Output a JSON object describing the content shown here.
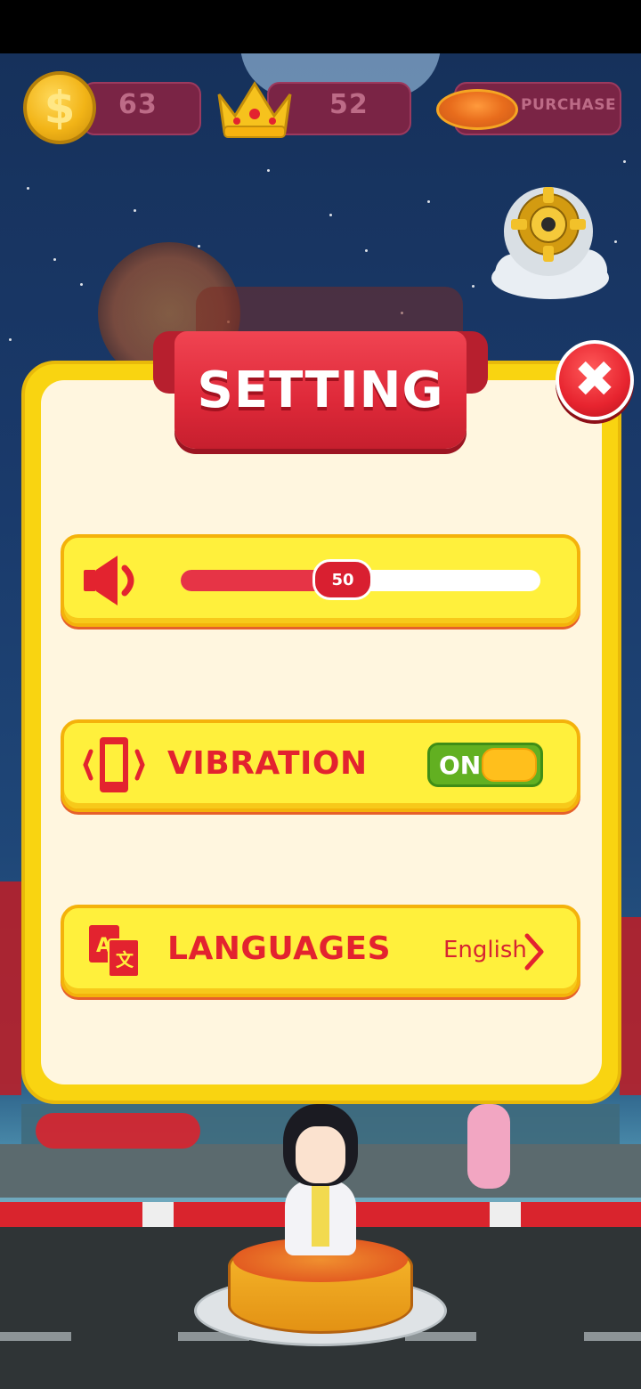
{
  "hud": {
    "coins": "63",
    "crowns": "52",
    "purchase_label": "PURCHASE",
    "coin_symbol": "$"
  },
  "settings": {
    "title": "SETTING",
    "close_symbol": "✖",
    "volume": {
      "value": "50",
      "level": 0.5
    },
    "vibration": {
      "label": "VIBRATION",
      "state": "ON"
    },
    "languages": {
      "label": "LANGUAGES",
      "value": "English"
    }
  },
  "colors": {
    "accent_red": "#e3232f",
    "panel_yellow": "#f9d411",
    "panel_cream": "#fff6df",
    "toggle_green": "#62b021"
  }
}
